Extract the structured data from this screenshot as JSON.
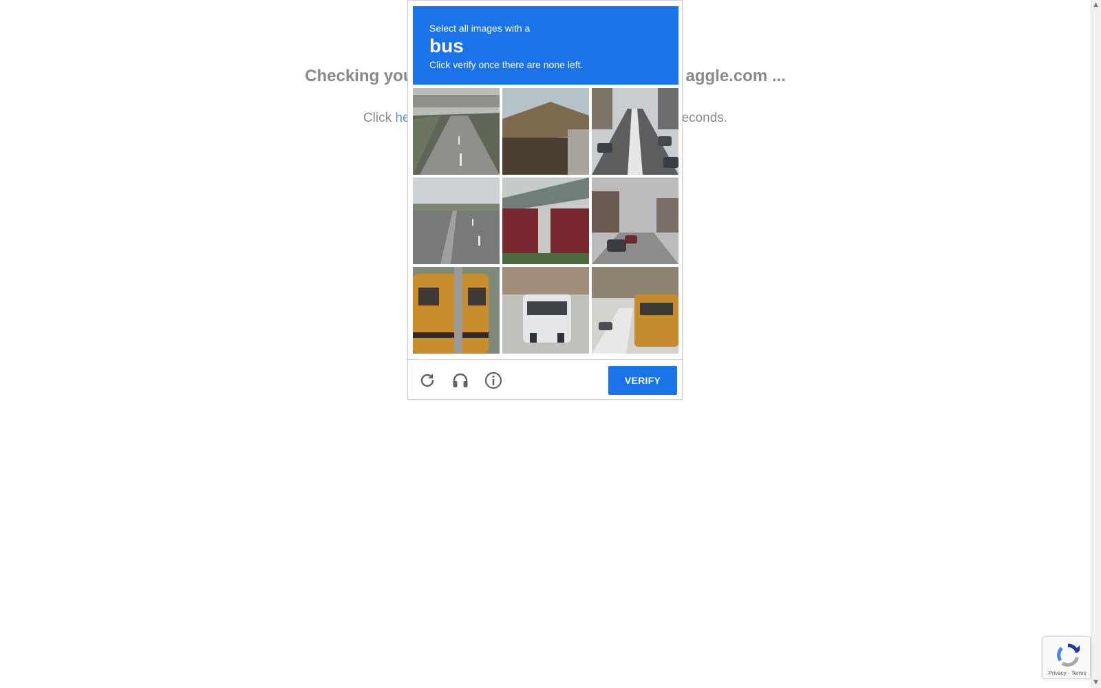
{
  "background": {
    "title_left": "Checking you",
    "title_right": "aggle.com ...",
    "line_prefix": "Click ",
    "line_link": "he",
    "line_suffix": "econds."
  },
  "captcha": {
    "header": {
      "instruction": "Select all images with a",
      "target_word": "bus",
      "subtext": "Click verify once there are none left."
    },
    "tiles": [
      {
        "content": "empty highway"
      },
      {
        "content": "house roof"
      },
      {
        "content": "snowy street with parked cars"
      },
      {
        "content": "multi-lane road"
      },
      {
        "content": "brick wall with bridge"
      },
      {
        "content": "residential street with cars"
      },
      {
        "content": "back of yellow school bus behind pole"
      },
      {
        "content": "white bus front near building"
      },
      {
        "content": "yellow school bus on snowy street"
      }
    ],
    "footer": {
      "reload_icon": "reload-icon",
      "audio_icon": "headphones-icon",
      "info_icon": "info-icon",
      "verify_label": "VERIFY"
    },
    "accent_color": "#1a73e8"
  },
  "badge": {
    "links": "Privacy - Terms"
  }
}
